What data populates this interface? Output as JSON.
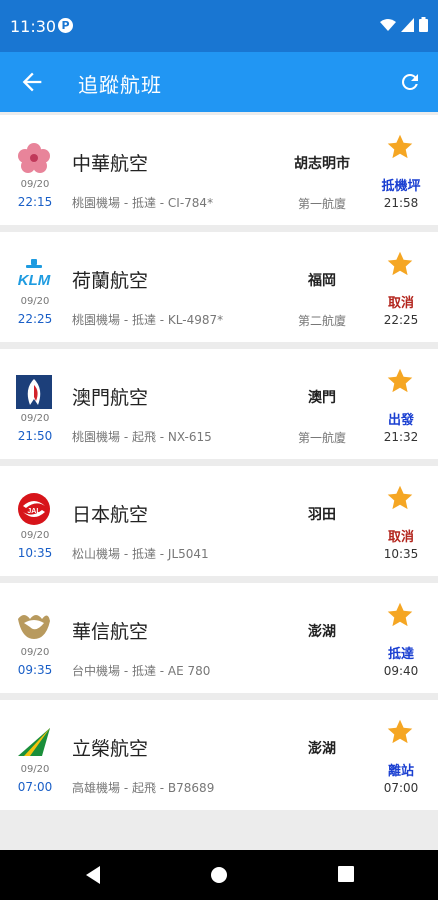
{
  "status_bar": {
    "time": "11:30"
  },
  "app_bar": {
    "title": "追蹤航班"
  },
  "colors": {
    "primary": "#2196f3",
    "status_bar": "#1976d2",
    "star": "#f5a623",
    "cancel": "#b3261e",
    "blue_status": "#1a3fd1"
  },
  "flights": [
    {
      "logo": "china-airlines-icon",
      "date": "09/20",
      "scheduled": "22:15",
      "airline": "中華航空",
      "detail": "桃園機場 - 抵達 - CI-784*",
      "city": "胡志明市",
      "terminal": "第一航廈",
      "status": "抵機坪",
      "status_color": "#1a3fd1",
      "actual": "21:58"
    },
    {
      "logo": "klm-icon",
      "date": "09/20",
      "scheduled": "22:25",
      "airline": "荷蘭航空",
      "detail": "桃園機場 - 抵達 - KL-4987*",
      "city": "福岡",
      "terminal": "第二航廈",
      "status": "取消",
      "status_color": "#b3261e",
      "actual": "22:25"
    },
    {
      "logo": "air-macau-icon",
      "date": "09/20",
      "scheduled": "21:50",
      "airline": "澳門航空",
      "detail": "桃園機場 - 起飛 - NX-615",
      "city": "澳門",
      "terminal": "第一航廈",
      "status": "出發",
      "status_color": "#1a3fd1",
      "actual": "21:32"
    },
    {
      "logo": "jal-icon",
      "date": "09/20",
      "scheduled": "10:35",
      "airline": "日本航空",
      "detail": "松山機場 - 抵達 - JL5041",
      "city": "羽田",
      "terminal": "",
      "status": "取消",
      "status_color": "#b3261e",
      "actual": "10:35"
    },
    {
      "logo": "mandarin-airlines-icon",
      "date": "09/20",
      "scheduled": "09:35",
      "airline": "華信航空",
      "detail": "台中機場 - 抵達 - AE 780",
      "city": "澎湖",
      "terminal": "",
      "status": "抵達",
      "status_color": "#1a3fd1",
      "actual": "09:40"
    },
    {
      "logo": "uni-air-icon",
      "date": "09/20",
      "scheduled": "07:00",
      "airline": "立榮航空",
      "detail": "高雄機場 - 起飛 - B78689",
      "city": "澎湖",
      "terminal": "",
      "status": "離站",
      "status_color": "#1a3fd1",
      "actual": "07:00"
    }
  ]
}
